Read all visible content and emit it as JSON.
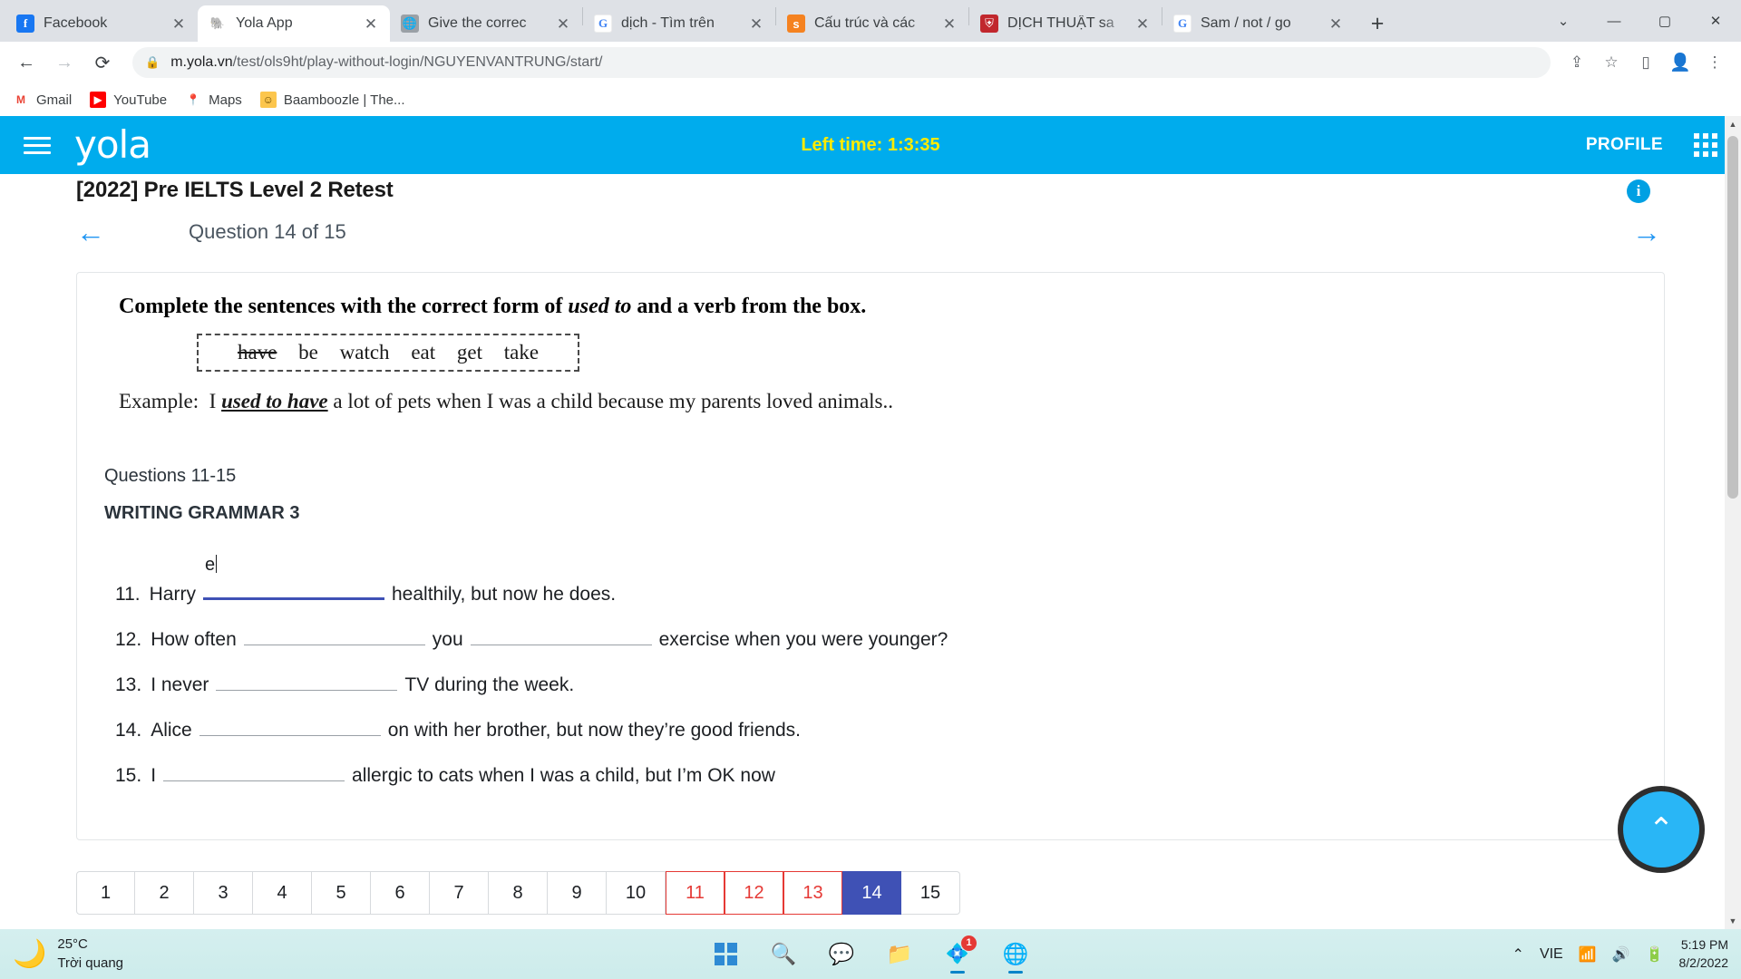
{
  "browser": {
    "tabs": [
      {
        "title": "Facebook",
        "icon": "facebook-icon",
        "active": false
      },
      {
        "title": "Yola App",
        "icon": "yola-elephant-icon",
        "active": true
      },
      {
        "title": "Give the correc",
        "icon": "globe-icon",
        "active": false
      },
      {
        "title": "dịch - Tìm trên",
        "icon": "google-icon",
        "active": false
      },
      {
        "title": "Cấu trúc và các",
        "icon": "studocu-icon",
        "active": false
      },
      {
        "title": "DỊCH THUẬT sa",
        "icon": "crest-icon",
        "active": false
      },
      {
        "title": "Sam / not / go",
        "icon": "google-icon",
        "active": false
      }
    ],
    "new_tab_label": "+",
    "window_controls": {
      "minimize": "—",
      "maximize": "▢",
      "close": "✕",
      "more": "⌄"
    },
    "nav": {
      "back": "←",
      "forward": "→",
      "reload": "⟳"
    },
    "omnibox": {
      "lock_icon": "lock-icon",
      "url_host": "m.yola.vn",
      "url_path": "/test/ols9ht/play-without-login/NGUYENVANTRUNG/start/"
    },
    "toolbar_icons": {
      "share": "⇪",
      "bookmark": "☆",
      "sidepanel": "▯",
      "profile": "avatar-icon",
      "menu": "⋮"
    },
    "bookmarks": [
      {
        "label": "Gmail",
        "icon": "gmail-icon"
      },
      {
        "label": "YouTube",
        "icon": "youtube-icon"
      },
      {
        "label": "Maps",
        "icon": "maps-pin-icon"
      },
      {
        "label": "Baamboozle | The...",
        "icon": "baamboozle-icon"
      }
    ]
  },
  "app": {
    "header": {
      "menu_icon": "hamburger-icon",
      "logo": "yola",
      "left_time": "Left time: 1:3:35",
      "profile_label": "PROFILE",
      "apps_icon": "grid-apps-icon"
    },
    "test_title": "[2022] Pre IELTS Level 2 Retest",
    "info_icon": "i",
    "question_nav": {
      "prev_icon": "←",
      "next_icon": "→",
      "title": "Question 14 of 15"
    },
    "exercise": {
      "instruction_pre": "Complete the sentences with the correct form of ",
      "instruction_em": "used to",
      "instruction_post": " and a verb from the box.",
      "word_bank": [
        {
          "word": "have",
          "struck": true
        },
        {
          "word": "be",
          "struck": false
        },
        {
          "word": "watch",
          "struck": false
        },
        {
          "word": "eat",
          "struck": false
        },
        {
          "word": "get",
          "struck": false
        },
        {
          "word": "take",
          "struck": false
        }
      ],
      "example_label": "Example:",
      "example_pre": "I ",
      "example_answer": "used to have",
      "example_post": " a lot of pets when I was a child because my parents loved animals.."
    },
    "questions_label": "Questions 11-15",
    "questions_sub": "WRITING GRAMMAR 3",
    "questions": [
      {
        "num": "11.",
        "pre": "Harry",
        "blank1_value": "e",
        "blank1_active": true,
        "mid": "",
        "blank2": false,
        "post": "healthily, but now he does."
      },
      {
        "num": "12.",
        "pre": "How often",
        "blank1_value": "",
        "blank1_active": false,
        "mid": "you",
        "blank2": true,
        "post": "exercise when you were younger?"
      },
      {
        "num": "13.",
        "pre": "I never",
        "blank1_value": "",
        "blank1_active": false,
        "mid": "",
        "blank2": false,
        "post": "TV during the week."
      },
      {
        "num": "14.",
        "pre": "Alice",
        "blank1_value": "",
        "blank1_active": false,
        "mid": "",
        "blank2": false,
        "post": "on with her brother, but now they’re good friends."
      },
      {
        "num": "15.",
        "pre": "I",
        "blank1_value": "",
        "blank1_active": false,
        "mid": "",
        "blank2": false,
        "post": "allergic to cats when I was a child, but I’m OK now"
      }
    ],
    "pager": [
      {
        "n": "1",
        "state": "normal"
      },
      {
        "n": "2",
        "state": "normal"
      },
      {
        "n": "3",
        "state": "normal"
      },
      {
        "n": "4",
        "state": "normal"
      },
      {
        "n": "5",
        "state": "normal"
      },
      {
        "n": "6",
        "state": "normal"
      },
      {
        "n": "7",
        "state": "normal"
      },
      {
        "n": "8",
        "state": "normal"
      },
      {
        "n": "9",
        "state": "normal"
      },
      {
        "n": "10",
        "state": "normal"
      },
      {
        "n": "11",
        "state": "flag"
      },
      {
        "n": "12",
        "state": "flag"
      },
      {
        "n": "13",
        "state": "flag"
      },
      {
        "n": "14",
        "state": "active"
      },
      {
        "n": "15",
        "state": "normal"
      }
    ],
    "scroll_top_icon": "^",
    "colors": {
      "brand": "#00aced",
      "timer": "#ffeb00",
      "active_page": "#3f51b5",
      "flag_page": "#e53935"
    }
  },
  "taskbar": {
    "weather": {
      "temp": "25°C",
      "desc": "Trời quang",
      "icon": "moon-icon"
    },
    "apps": [
      {
        "name": "start-button",
        "icon": "windows-logo-icon"
      },
      {
        "name": "search-button",
        "icon": "search-icon"
      },
      {
        "name": "teams-button",
        "icon": "teams-icon"
      },
      {
        "name": "file-explorer-button",
        "icon": "folder-icon"
      },
      {
        "name": "zalo-button",
        "icon": "zalo-icon",
        "badge": "1"
      },
      {
        "name": "chrome-button",
        "icon": "chrome-icon"
      }
    ],
    "tray": {
      "chevron": "⌃",
      "language": "VIE",
      "wifi": "wifi-icon",
      "volume": "volume-icon",
      "battery": "battery-icon"
    },
    "clock": {
      "time": "5:19 PM",
      "date": "8/2/2022"
    }
  }
}
